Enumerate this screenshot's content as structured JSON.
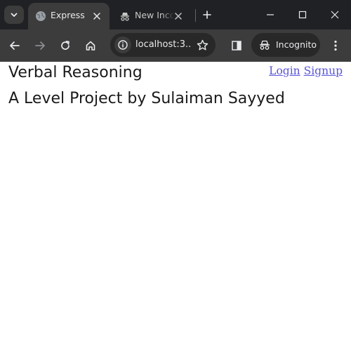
{
  "browser": {
    "tabs": [
      {
        "title": "Express",
        "active": true
      },
      {
        "title": "New Incognito Tab",
        "active": false
      }
    ],
    "address_bar": {
      "url": "localhost:3..."
    },
    "profile_chip": {
      "label": "Incognito"
    },
    "theme": {
      "tabstrip_bg": "#202124",
      "toolbar_bg": "#3c3c3c",
      "text": "#e8eaed"
    }
  },
  "page": {
    "title": "Verbal Reasoning",
    "subtitle": "A Level Project by Sulaiman Sayyed",
    "nav": {
      "login": "Login",
      "signup": "Signup"
    },
    "link_color": "#5a55d8"
  }
}
